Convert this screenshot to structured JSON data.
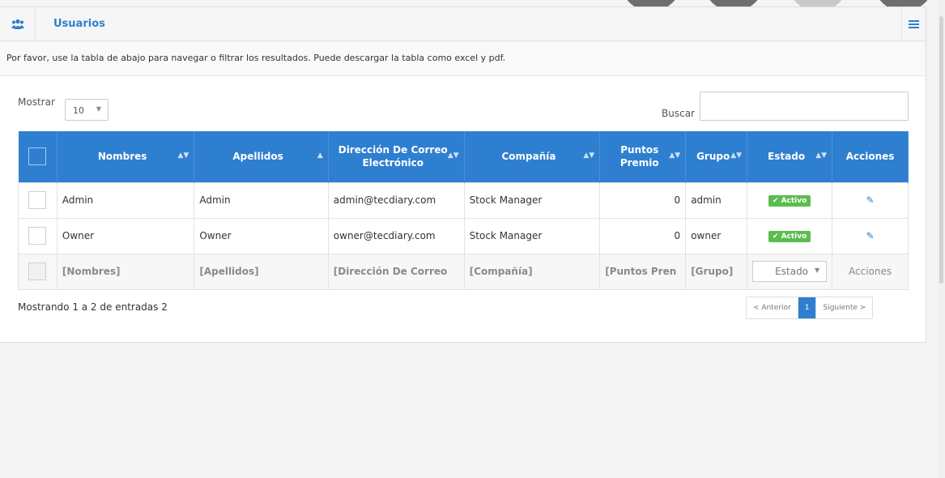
{
  "panel": {
    "title": "Usuarios",
    "icon": "users-icon",
    "menu_icon": "menu-icon",
    "intro": "Por favor, use la tabla de abajo para navegar o filtrar los resultados. Puede descargar la tabla como excel y pdf."
  },
  "controls": {
    "show_label": "Mostrar",
    "length_value": "10",
    "search_label": "Buscar",
    "search_value": ""
  },
  "table": {
    "headers": {
      "nombres": "Nombres",
      "apellidos": "Apellidos",
      "correo": "Dirección De Correo Electrónico",
      "compania": "Compañía",
      "puntos": "Puntos Premio",
      "grupo": "Grupo",
      "estado": "Estado",
      "acciones": "Acciones"
    },
    "rows": [
      {
        "nombres": "Admin",
        "apellidos": "Admin",
        "correo": "admin@tecdiary.com",
        "compania": "Stock Manager",
        "puntos": "0",
        "grupo": "admin",
        "estado": "✔ Activo"
      },
      {
        "nombres": "Owner",
        "apellidos": "Owner",
        "correo": "owner@tecdiary.com",
        "compania": "Stock Manager",
        "puntos": "0",
        "grupo": "owner",
        "estado": "✔ Activo"
      }
    ],
    "filters": {
      "nombres": "[Nombres]",
      "apellidos": "[Apellidos]",
      "correo": "[Dirección De Correo",
      "compania": "[Compañía]",
      "puntos": "[Puntos Pren",
      "grupo": "[Grupo]",
      "estado": "Estado",
      "acciones": "Acciones"
    }
  },
  "footer": {
    "info": "Mostrando 1 a 2 de entradas 2",
    "prev": "< Anterior",
    "page": "1",
    "next": "Siguiente >"
  },
  "colors": {
    "primary": "#2e7fd0",
    "success": "#5bbd4f"
  }
}
